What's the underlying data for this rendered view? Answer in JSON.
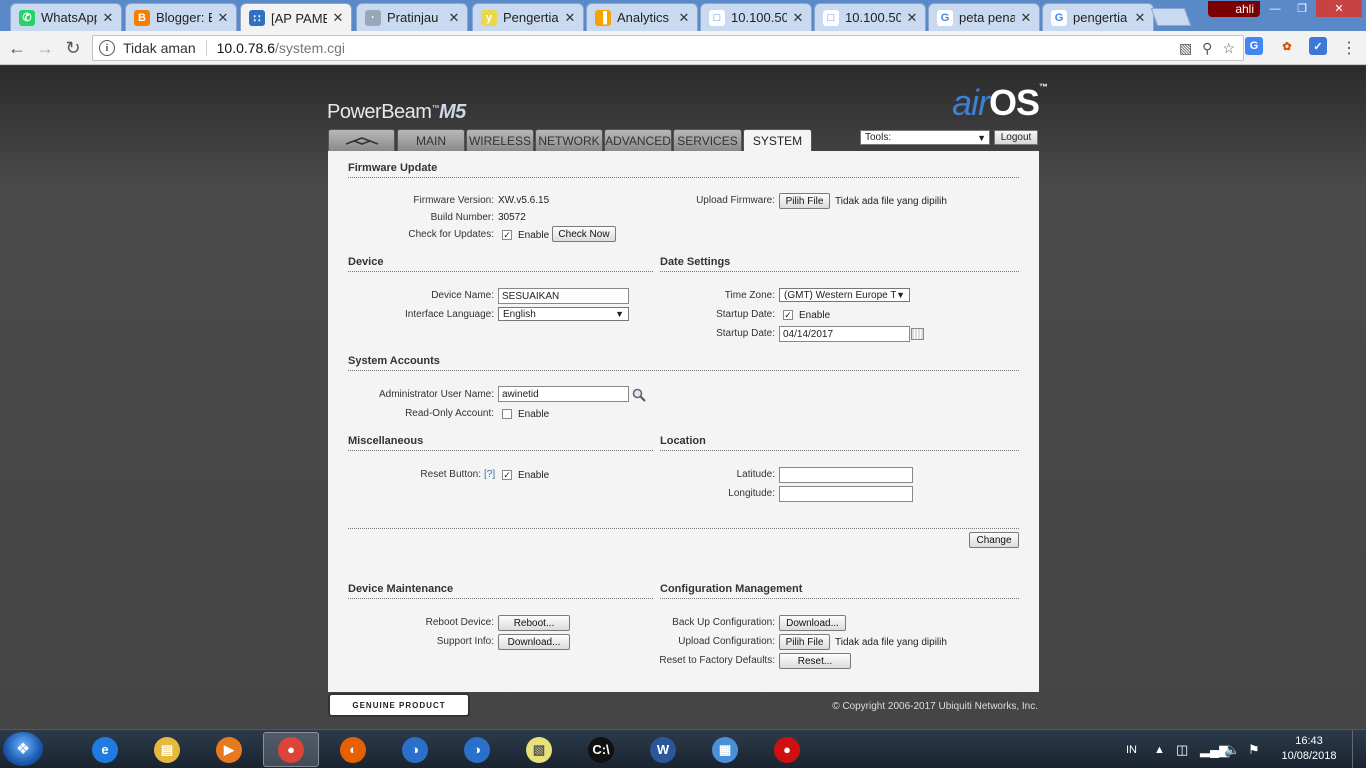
{
  "browser": {
    "tabs": [
      {
        "title": "WhatsApp",
        "favicon": "whatsapp-icon",
        "color": "#25D366",
        "glyph": "✆"
      },
      {
        "title": "Blogger: B",
        "favicon": "blogger-icon",
        "color": "#F57D00",
        "glyph": "B"
      },
      {
        "title": "[AP PAMEI",
        "favicon": "wifi-signal-icon",
        "color": "#2f6fc4",
        "glyph": "∷"
      },
      {
        "title": "Pratinjau",
        "favicon": "blog-preview-icon",
        "color": "#9aa7b8",
        "glyph": "·"
      },
      {
        "title": "Pengertian",
        "favicon": "site-y-icon",
        "color": "#e8d84a",
        "glyph": "y"
      },
      {
        "title": "Analytics",
        "favicon": "analytics-icon",
        "color": "#f4a300",
        "glyph": "▐"
      },
      {
        "title": "10.100.50.",
        "favicon": "document-icon",
        "color": "#ffffff",
        "glyph": "□"
      },
      {
        "title": "10.100.50.",
        "favicon": "document-icon",
        "color": "#ffffff",
        "glyph": "□"
      },
      {
        "title": "peta pena",
        "favicon": "google-icon",
        "color": "#ffffff",
        "glyph": "G"
      },
      {
        "title": "pengertia",
        "favicon": "google-icon",
        "color": "#ffffff",
        "glyph": "G"
      }
    ],
    "active_tab": 2,
    "profile_name": "ahli",
    "address": {
      "security_label": "Tidak aman",
      "host": "10.0.78.6",
      "path": "/system.cgi"
    }
  },
  "header": {
    "product_name": "PowerBeam",
    "product_model": "M5",
    "os_logo_air": "air",
    "os_logo_os": "OS",
    "nav_tabs": [
      "",
      "MAIN",
      "WIRELESS",
      "NETWORK",
      "ADVANCED",
      "SERVICES",
      "SYSTEM"
    ],
    "active_nav": "SYSTEM",
    "tools_label": "Tools:",
    "logout_label": "Logout"
  },
  "firmware": {
    "heading": "Firmware Update",
    "version_label": "Firmware Version:",
    "version_value": "XW.v5.6.15",
    "build_label": "Build Number:",
    "build_value": "30572",
    "check_label": "Check for Updates:",
    "check_enabled": "Enable",
    "check_now_button": "Check Now",
    "upload_label": "Upload Firmware:",
    "choose_file_button": "Pilih File",
    "no_file_text": "Tidak ada file yang dipilih"
  },
  "device": {
    "heading": "Device",
    "name_label": "Device Name:",
    "name_value": "SESUAIKAN",
    "language_label": "Interface Language:",
    "language_value": "English"
  },
  "date_settings": {
    "heading": "Date Settings",
    "timezone_label": "Time Zone:",
    "timezone_value": "(GMT) Western Europe T",
    "startup_date_enable_label": "Startup Date:",
    "startup_enable_text": "Enable",
    "startup_date_label": "Startup Date:",
    "startup_date_value": "04/14/2017"
  },
  "accounts": {
    "heading": "System Accounts",
    "admin_label": "Administrator User Name:",
    "admin_value": "awinetid",
    "readonly_label": "Read-Only Account:",
    "readonly_enable_text": "Enable"
  },
  "misc": {
    "heading": "Miscellaneous",
    "reset_label": "Reset Button:",
    "reset_help": "[?]",
    "reset_enable_text": "Enable"
  },
  "location": {
    "heading": "Location",
    "latitude_label": "Latitude:",
    "latitude_value": "",
    "longitude_label": "Longitude:",
    "longitude_value": ""
  },
  "change_button": "Change",
  "maintenance": {
    "heading": "Device Maintenance",
    "reboot_label": "Reboot Device:",
    "reboot_button": "Reboot...",
    "support_label": "Support Info:",
    "support_button": "Download..."
  },
  "config": {
    "heading": "Configuration Management",
    "backup_label": "Back Up Configuration:",
    "backup_button": "Download...",
    "upload_label": "Upload Configuration:",
    "choose_file_button": "Pilih File",
    "no_file_text": "Tidak ada file yang dipilih",
    "reset_label": "Reset to Factory Defaults:",
    "reset_button": "Reset..."
  },
  "footer": {
    "genuine_text": "GENUINE PRODUCT",
    "copyright": "© Copyright 2006-2017 Ubiquiti Networks, Inc."
  },
  "taskbar": {
    "items": [
      {
        "name": "internet-explorer-icon",
        "color": "#1f7be0",
        "glyph": "e"
      },
      {
        "name": "file-explorer-icon",
        "color": "#e6b83c",
        "glyph": "▤"
      },
      {
        "name": "media-player-icon",
        "color": "#e87a1e",
        "glyph": "▶"
      },
      {
        "name": "chrome-icon",
        "color": "#db4437",
        "glyph": "●"
      },
      {
        "name": "firefox-icon",
        "color": "#e66000",
        "glyph": "◐"
      },
      {
        "name": "winbox-icon",
        "color": "#2a6fc9",
        "glyph": "◑"
      },
      {
        "name": "winbox-icon-2",
        "color": "#2a6fc9",
        "glyph": "◑"
      },
      {
        "name": "sticky-notes-icon",
        "color": "#e8e07a",
        "glyph": "▧"
      },
      {
        "name": "command-prompt-icon",
        "color": "#111111",
        "glyph": "C:\\"
      },
      {
        "name": "word-icon",
        "color": "#2b579a",
        "glyph": "W"
      },
      {
        "name": "control-panel-icon",
        "color": "#4a90d9",
        "glyph": "▦"
      },
      {
        "name": "record-icon",
        "color": "#d01010",
        "glyph": "●"
      }
    ],
    "active_item": 3,
    "language": "IN",
    "time": "16:43",
    "date": "10/08/2018"
  }
}
